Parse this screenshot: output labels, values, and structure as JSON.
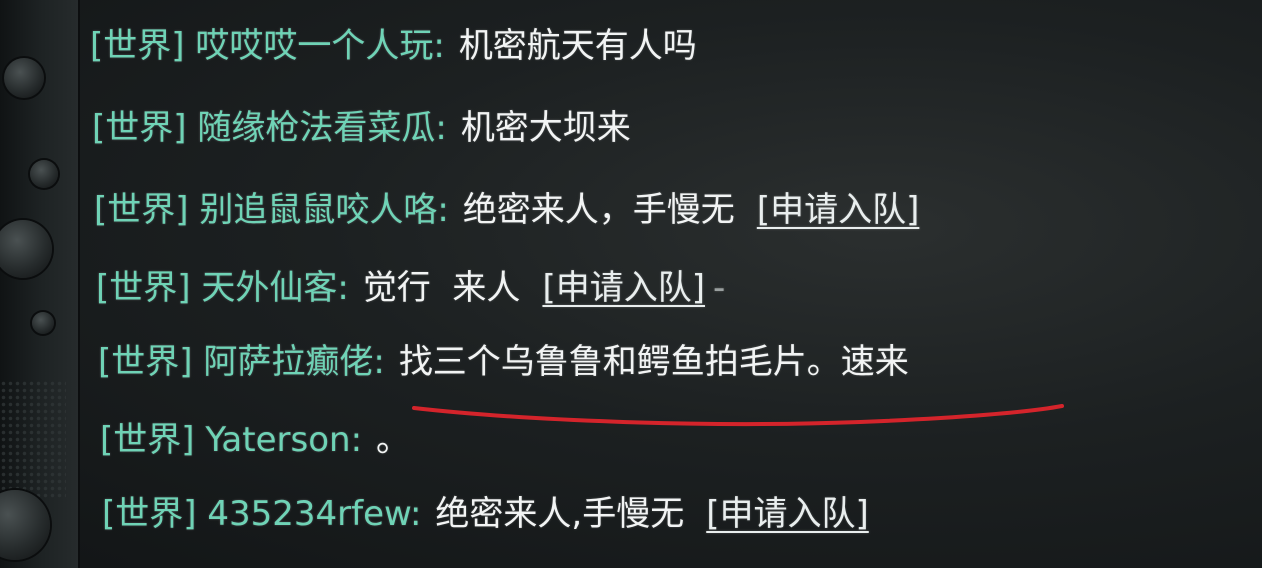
{
  "chat": {
    "messages": [
      {
        "channel": "[世界]",
        "sender": "哎哎哎一个人玩",
        "colon": ":",
        "text": "机密航天有人吗",
        "join": ""
      },
      {
        "channel": "[世界]",
        "sender": "随缘枪法看菜瓜",
        "colon": ":",
        "text": "机密大坝来",
        "join": ""
      },
      {
        "channel": "[世界]",
        "sender": "别追鼠鼠咬人咯",
        "colon": ":",
        "text": "绝密来人，手慢无",
        "join": "[申请入队]"
      },
      {
        "channel": "[世界]",
        "sender": "天外仙客",
        "colon": ":",
        "text": "觉行  来人",
        "join": "[申请入队]"
      },
      {
        "channel": "[世界]",
        "sender": "阿萨拉癫佬",
        "colon": ":",
        "text": "找三个乌鲁鲁和鳄鱼拍毛片。速来",
        "join": ""
      },
      {
        "channel": "[世界]",
        "sender": "Yaterson",
        "colon": ":",
        "text": "。",
        "join": ""
      },
      {
        "channel": "[世界]",
        "sender": "435234rfew",
        "colon": ":",
        "text": "绝密来人,手慢无",
        "join": "[申请入队]"
      }
    ],
    "dash_after_row4": "-"
  },
  "colors": {
    "channel": "#6fd3b6",
    "message": "#f2f4f4",
    "annotation_underline": "#d4242b",
    "background": "#1c2021"
  },
  "icons": {
    "hardware": "device-bezel-knobs"
  }
}
